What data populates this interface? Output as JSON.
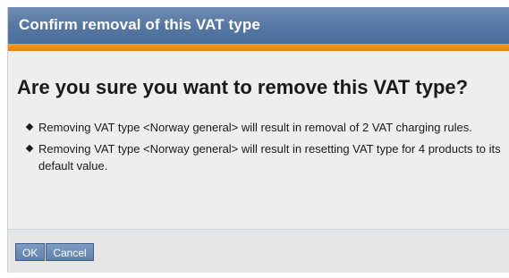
{
  "dialog": {
    "title": "Confirm removal of this VAT type",
    "question": "Are you sure you want to remove this VAT type?",
    "consequences": [
      "Removing VAT type <Norway general> will result in removal of 2 VAT charging rules.",
      "Removing VAT type <Norway general> will result in resetting VAT type for 4 products to its default value."
    ],
    "buttons": {
      "ok": "OK",
      "cancel": "Cancel"
    }
  },
  "colors": {
    "title_bar": "#5476a3",
    "accent_rule": "#e88a16",
    "panel_background": "#eeeeee",
    "button": "#6f8db5"
  }
}
